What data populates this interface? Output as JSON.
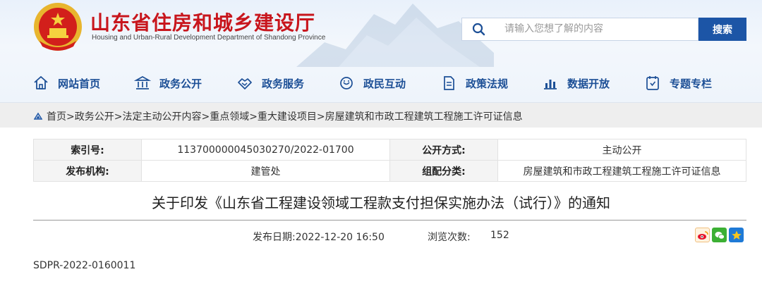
{
  "header": {
    "site_title": "山东省住房和城乡建设厅",
    "site_subtitle": "Housing and Urban-Rural Development Department of Shandong Province"
  },
  "search": {
    "placeholder": "请输入您想了解的内容",
    "button_label": "搜索"
  },
  "nav": {
    "items": [
      {
        "label": "网站首页",
        "icon": "home-icon"
      },
      {
        "label": "政务公开",
        "icon": "building-icon"
      },
      {
        "label": "政务服务",
        "icon": "handshake-icon"
      },
      {
        "label": "政民互动",
        "icon": "chat-icon"
      },
      {
        "label": "政策法规",
        "icon": "document-icon"
      },
      {
        "label": "数据开放",
        "icon": "bar-chart-icon"
      },
      {
        "label": "专题专栏",
        "icon": "column-icon"
      }
    ]
  },
  "breadcrumb": {
    "text": "首页>政务公开>法定主动公开内容>重点领域>重大建设项目>房屋建筑和市政工程建筑工程施工许可证信息"
  },
  "meta": {
    "index_label": "索引号:",
    "index_value": "113700000045030270/2022-01700",
    "disclosure_label": "公开方式:",
    "disclosure_value": "主动公开",
    "publisher_label": "发布机构:",
    "publisher_value": "建管处",
    "category_label": "组配分类:",
    "category_value": "房屋建筑和市政工程建筑工程施工许可证信息"
  },
  "article": {
    "title": "关于印发《山东省工程建设领域工程款支付担保实施办法（试行）》的通知",
    "publish_date": "发布日期:2022-12-20 16:50",
    "views_label": "浏览次数:",
    "views_value": "152",
    "doc_number": "SDPR-2022-0160011"
  },
  "colors": {
    "brand_red": "#c8161d",
    "nav_blue": "#1c4f96",
    "search_button": "#1c55a6"
  }
}
